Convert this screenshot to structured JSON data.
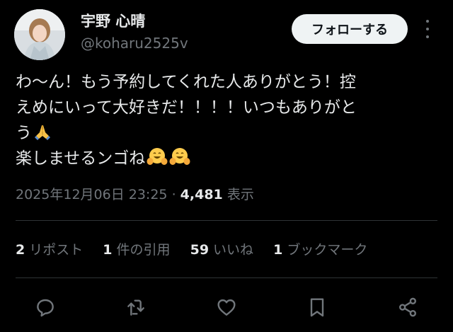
{
  "user": {
    "display_name": "宇野 心晴",
    "handle": "@koharu2525v",
    "avatar_icon": "profile-photo"
  },
  "header": {
    "follow_label": "フォローする",
    "more_icon": "more-vertical-icon"
  },
  "tweet": {
    "lines": [
      "わ〜ん！もう予約してくれた人ありがとう！控",
      "えめにいって大好きだ！！！！いつもありがと",
      "う",
      "楽しませるンゴね"
    ],
    "emojis": [
      "folded-hands",
      "hugging-face",
      "hugging-face"
    ]
  },
  "meta": {
    "timestamp": "2025年12月06日 23:25",
    "separator": "·",
    "views": "4,481",
    "views_label": "表示"
  },
  "stats": {
    "reposts": {
      "count": "2",
      "label": "リポスト"
    },
    "quotes": {
      "count": "1",
      "label": "件の引用"
    },
    "likes": {
      "count": "59",
      "label": "いいね"
    },
    "bookmarks": {
      "count": "1",
      "label": "ブックマーク"
    }
  },
  "actions": [
    "reply-icon",
    "repost-icon",
    "like-icon",
    "bookmark-icon",
    "share-icon"
  ],
  "colors": {
    "background": "#000000",
    "text": "#e7e9ea",
    "secondary_text": "#71767b",
    "divider": "#2f3336",
    "follow_button_bg": "#eff3f4"
  }
}
